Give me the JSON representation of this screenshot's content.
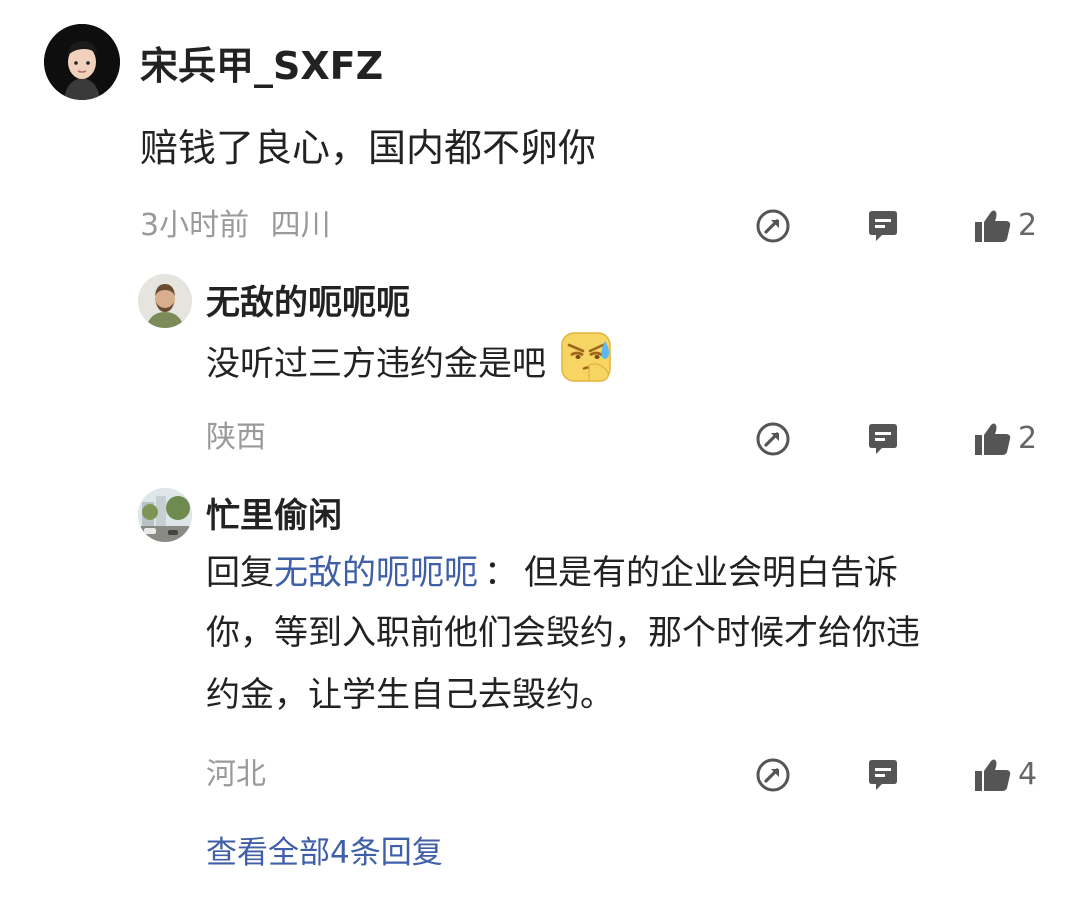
{
  "comment": {
    "username": "宋兵甲_SXFZ",
    "text": "赔钱了良心，国内都不卵你",
    "time": "3小时前",
    "location": "四川",
    "likes": "2"
  },
  "replies": [
    {
      "username": "无敌的呃呃呃",
      "text": "没听过三方违约金是吧",
      "location": "陕西",
      "likes": "2"
    },
    {
      "username": "忙里偷闲",
      "reply_prefix": "回复",
      "mention": "无敌的呃呃呃",
      "separator": "：",
      "text_line1": "但是有的企业会明白告诉",
      "text_line2": "你，等到入职前他们会毁约，那个时候才给你违",
      "text_line3": "约金，让学生自己去毁约。",
      "location": "河北",
      "likes": "4"
    }
  ],
  "view_all_replies": "查看全部4条回复",
  "icons": {
    "share": "share-icon",
    "reply": "comment-icon",
    "like": "thumbs-up-icon",
    "emoji": "sweat-emoji-icon"
  }
}
